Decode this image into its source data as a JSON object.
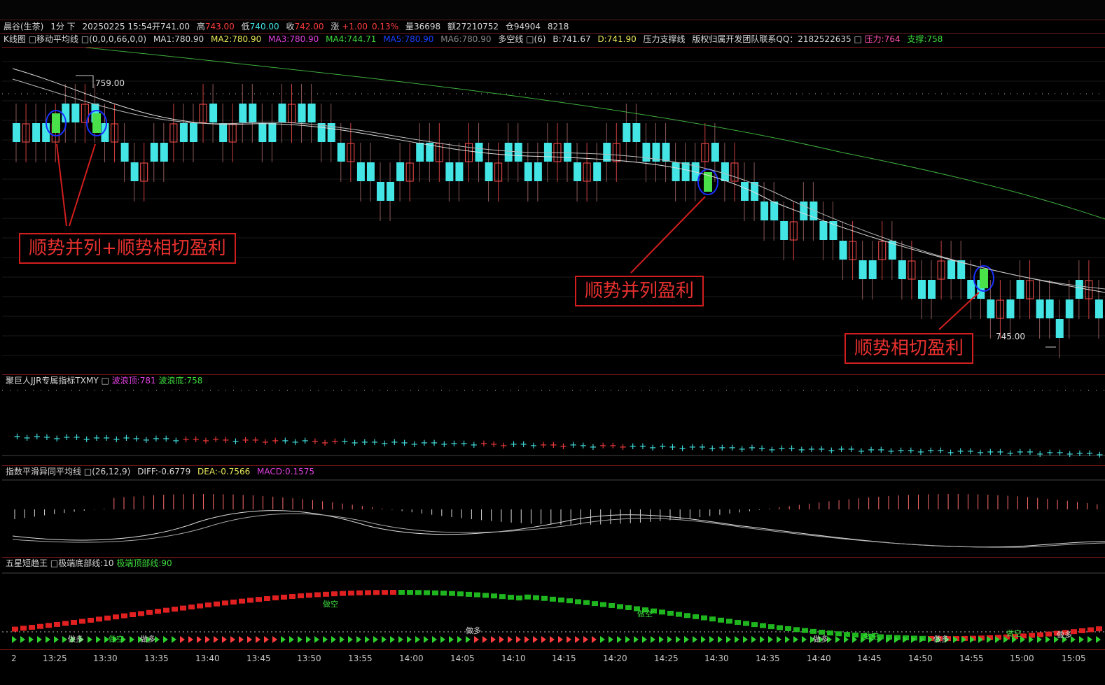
{
  "info_bar": {
    "symbol": "晨谷(生茶)",
    "period": "1分 下",
    "datetime": "20250225 15:54",
    "open_label": "开",
    "open": "741.00",
    "high_label": "高",
    "high": "743.00",
    "low_label": "低",
    "low": "740.00",
    "close_label": "收",
    "close": "742.00",
    "change_label": "涨",
    "change": "+1.00",
    "change_pct": "0.13%",
    "volume_label": "量",
    "volume": "36698",
    "amount_label": "额",
    "amount": "27210752",
    "position_label": "仓",
    "position": "94904",
    "extra": "8218"
  },
  "kline_legend": {
    "title": "K线图",
    "ma_indicator": "移动平均线",
    "ma_params": "(0,0,0,66,0,0)",
    "ma1": "MA1:780.90",
    "ma2": "MA2:780.90",
    "ma3": "MA3:780.90",
    "ma4": "MA4:744.71",
    "ma5": "MA5:780.90",
    "ma6": "MA6:780.90",
    "bull_bear": "多空线",
    "bull_bear_params": "(6)",
    "b_value": "B:741.67",
    "d_value": "D:741.90",
    "support_line": "压力支撑线",
    "copyright": "版权归属开发团队联系QQ：2182522635",
    "pressure": "压力:764",
    "support": "支撑:758"
  },
  "kline_pane": {
    "high_marker": "759.00",
    "low_marker": "745.00",
    "callout_1": "顺势并列+顺势相切盈利",
    "callout_2": "顺势并列盈利",
    "callout_3": "顺势相切盈利"
  },
  "wave_pane": {
    "title": "聚巨人JJR专属指标TXMY",
    "top_label": "波浪顶:781",
    "bottom_label": "波浪底:758"
  },
  "macd_pane": {
    "title": "指数平滑异同平均线",
    "params": "(26,12,9)",
    "diff": "DIFF:-0.6779",
    "dea": "DEA:-0.7566",
    "macd": "MACD:0.1575"
  },
  "trend_pane": {
    "title": "五星短趋王",
    "bottom_line": "极端底部线:10",
    "top_line": "极端顶部线:90",
    "signals": [
      "做多",
      "做空",
      "做多",
      "做空",
      "做多",
      "做空",
      "做多",
      "做空",
      "做多",
      "做空",
      "做多"
    ]
  },
  "time_axis": {
    "ticks": [
      "2",
      "13:25",
      "13:30",
      "13:35",
      "13:40",
      "13:45",
      "13:50",
      "13:55",
      "14:00",
      "14:05",
      "14:10",
      "14:15",
      "14:20",
      "14:25",
      "14:30",
      "14:35",
      "14:40",
      "14:45",
      "14:50",
      "14:55",
      "15:00",
      "15:05"
    ]
  },
  "colors": {
    "up": "#ff5050",
    "down": "#43e5e5",
    "highlight": "#49e04a",
    "ring": "#1830ff",
    "callout": "#d21e1e",
    "grid": "#5a1a1a"
  }
}
